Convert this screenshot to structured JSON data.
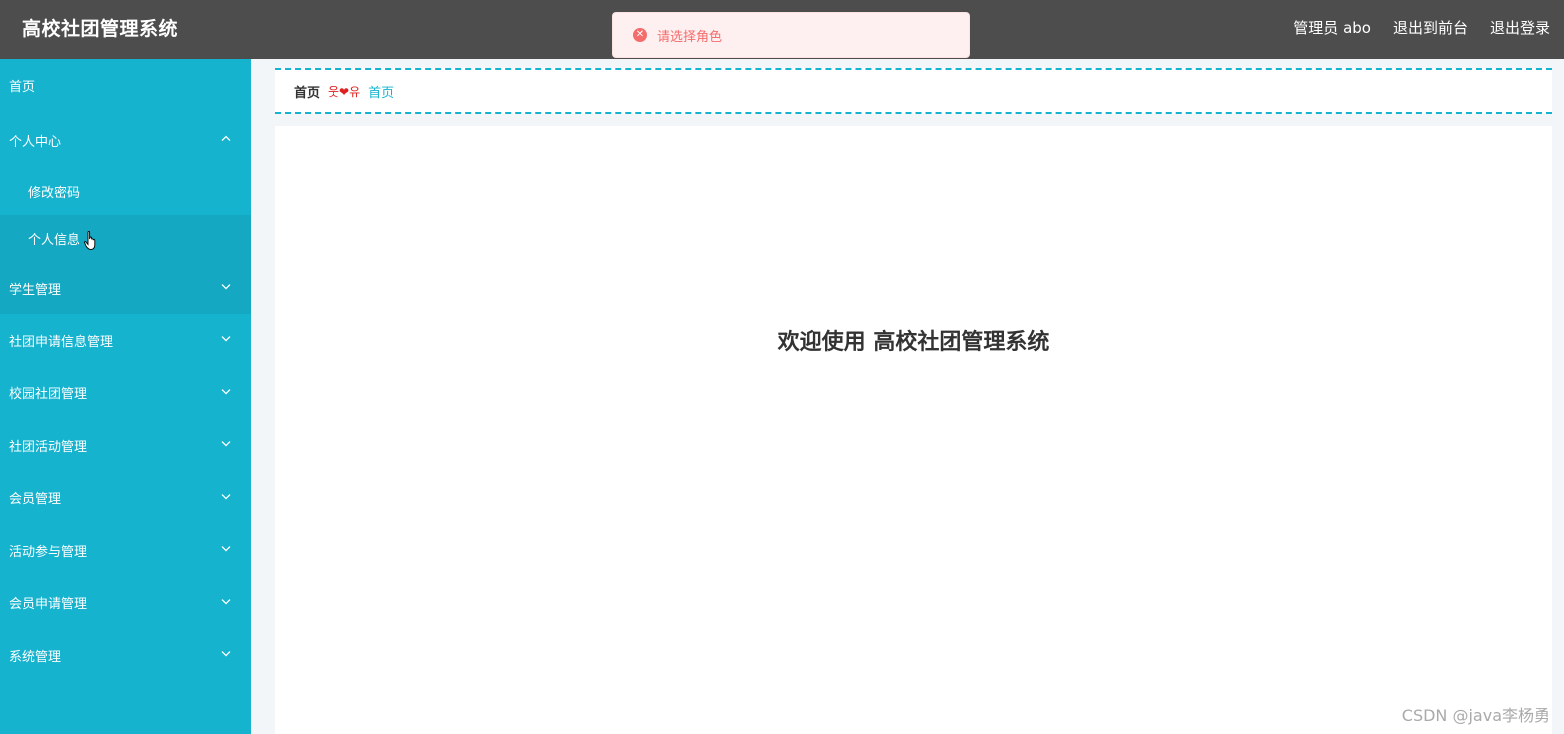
{
  "app": {
    "title": "高校社团管理系统"
  },
  "header": {
    "user_label": "管理员 abo",
    "to_front_label": "退出到前台",
    "logout_label": "退出登录"
  },
  "toast": {
    "type": "error",
    "message": "请选择角色"
  },
  "sidebar": {
    "items": [
      {
        "label": "首页",
        "expandable": false
      },
      {
        "label": "个人中心",
        "expandable": true,
        "expanded": true,
        "children": [
          {
            "label": "修改密码"
          },
          {
            "label": "个人信息"
          }
        ]
      },
      {
        "label": "学生管理",
        "expandable": true
      },
      {
        "label": "社团申请信息管理",
        "expandable": true
      },
      {
        "label": "校园社团管理",
        "expandable": true
      },
      {
        "label": "社团活动管理",
        "expandable": true
      },
      {
        "label": "会员管理",
        "expandable": true
      },
      {
        "label": "活动参与管理",
        "expandable": true
      },
      {
        "label": "会员申请管理",
        "expandable": true
      },
      {
        "label": "系统管理",
        "expandable": true
      }
    ]
  },
  "breadcrumb": {
    "home": "首页",
    "separator": "웃❤유",
    "current": "首页"
  },
  "main": {
    "welcome": "欢迎使用 高校社团管理系统"
  },
  "watermark": "CSDN @java李杨勇",
  "colors": {
    "accent": "#16b3cf",
    "header_bg": "#4d4d4d",
    "error": "#f56c6c"
  }
}
